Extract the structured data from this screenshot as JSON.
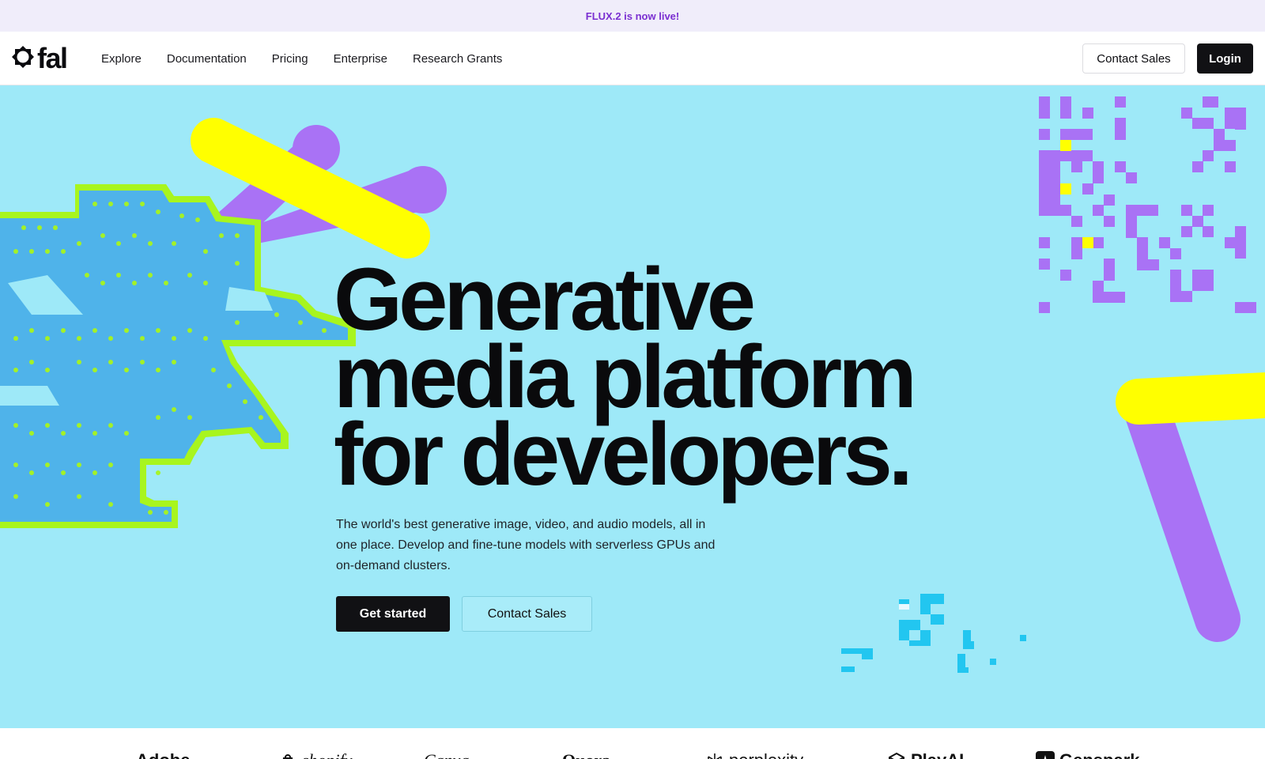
{
  "announcement": {
    "text": "FLUX.2 is now live!",
    "color": "#7a2fd1"
  },
  "brand": {
    "name": "fal",
    "logo_icon": "fal-ring-icon"
  },
  "nav": {
    "items": [
      {
        "label": "Explore"
      },
      {
        "label": "Documentation"
      },
      {
        "label": "Pricing"
      },
      {
        "label": "Enterprise"
      },
      {
        "label": "Research Grants"
      }
    ]
  },
  "header_actions": {
    "contact_sales": "Contact Sales",
    "login": "Login"
  },
  "hero": {
    "headline": [
      "Generative",
      "media platform",
      "for developers."
    ],
    "subtext": "The world's best generative image, video, and audio models, all in one place. Develop and fine-tune models with serverless GPUs and on-demand clusters.",
    "primary_cta": "Get started",
    "secondary_cta": "Contact Sales",
    "colors": {
      "background": "#9ee9f8",
      "yellow": "#ffff00",
      "purple": "#a972f5",
      "pixel_blue": "#4fb3ea",
      "pixel_green": "#a8f51e",
      "pixel_cyan": "#22c6f0"
    }
  },
  "customer_logos": [
    {
      "name": "Adobe"
    },
    {
      "name": "shopify",
      "icon": "shopify-bag-icon"
    },
    {
      "name": "Canva"
    },
    {
      "name": "Quora"
    },
    {
      "name": "perplexity",
      "icon": "perplexity-icon"
    },
    {
      "name": "PlayAI",
      "icon": "playai-cube-icon"
    },
    {
      "name": "Genspark",
      "icon": "genspark-icon"
    }
  ]
}
